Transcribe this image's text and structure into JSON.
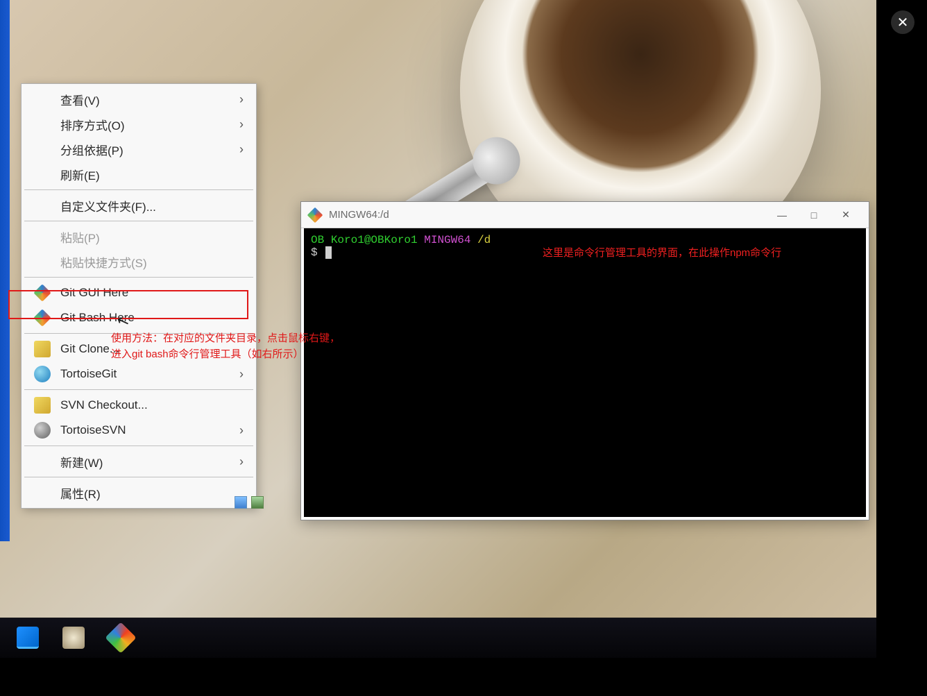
{
  "viewer": {
    "close_glyph": "✕"
  },
  "context_menu": {
    "items": {
      "view": {
        "label": "查看(V)",
        "has_sub": true
      },
      "sort": {
        "label": "排序方式(O)",
        "has_sub": true
      },
      "group": {
        "label": "分组依据(P)",
        "has_sub": true
      },
      "refresh": {
        "label": "刷新(E)"
      },
      "customize": {
        "label": "自定义文件夹(F)..."
      },
      "paste": {
        "label": "粘贴(P)",
        "disabled": true
      },
      "paste_sc": {
        "label": "粘贴快捷方式(S)",
        "disabled": true
      },
      "git_gui": {
        "label": "Git GUI Here"
      },
      "git_bash": {
        "label": "Git Bash Here"
      },
      "git_clone": {
        "label": "Git Clone..."
      },
      "tortoisegit": {
        "label": "TortoiseGit",
        "has_sub": true
      },
      "svn_co": {
        "label": "SVN Checkout..."
      },
      "tortoisesvn": {
        "label": "TortoiseSVN",
        "has_sub": true
      },
      "new": {
        "label": "新建(W)",
        "has_sub": true
      },
      "properties": {
        "label": "属性(R)"
      }
    }
  },
  "annotations": {
    "usage": "使用方法：在对应的文件夹目录，点击鼠标右键，\n进入git bash命令行管理工具（如右所示）",
    "terminal_note": "这里是命令行管理工具的界面，在此操作npm命令行"
  },
  "terminal": {
    "title": "MINGW64:/d",
    "prompt": {
      "pre": "OB ",
      "user_host": "Koro1@OBKoro1",
      "env": " MINGW64 ",
      "path": "/d"
    },
    "ps": "$ "
  },
  "glyphs": {
    "chevron": "›"
  }
}
